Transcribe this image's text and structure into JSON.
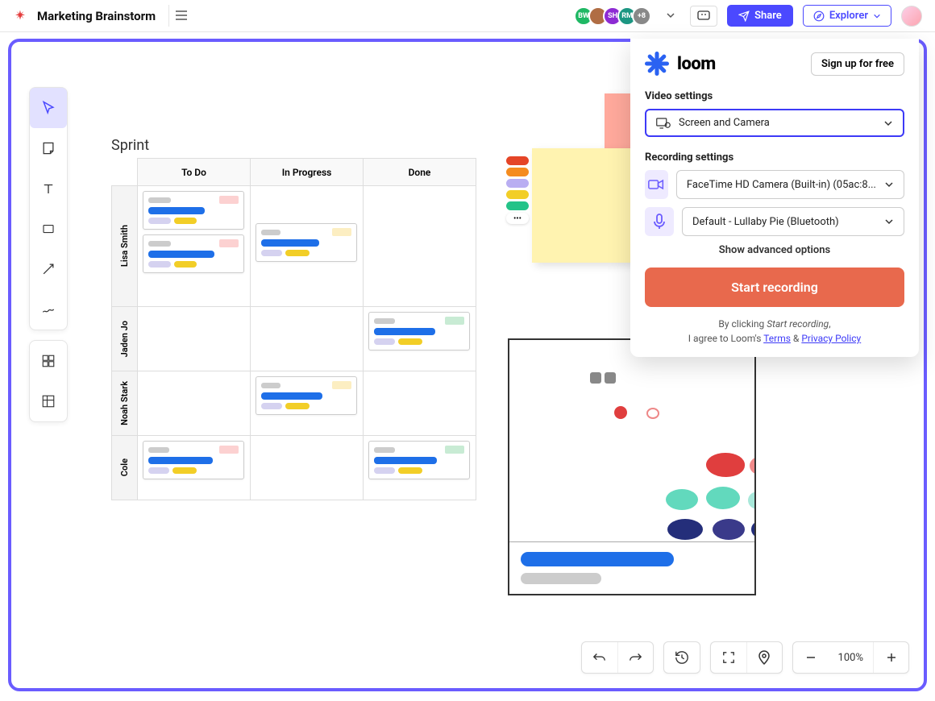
{
  "header": {
    "title": "Marketing Brainstorm",
    "share_label": "Share",
    "explorer_label": "Explorer",
    "avatars": [
      {
        "label": "BW",
        "bg": "#1fb864"
      },
      {
        "label": "",
        "bg": "#b06d44"
      },
      {
        "label": "SH",
        "bg": "#8d2bd3"
      },
      {
        "label": "RM",
        "bg": "#1c9682"
      }
    ],
    "more_count": "+8"
  },
  "sprint": {
    "title": "Sprint",
    "columns": [
      "To Do",
      "In Progress",
      "Done"
    ],
    "rows": [
      "Lisa Smith",
      "Jaden Jo",
      "Noah Stark",
      "Cole"
    ]
  },
  "sticky_colors": [
    "#e54527",
    "#f58c1f",
    "#b9aef2",
    "#f2ce27",
    "#24c388"
  ],
  "loom": {
    "brand": "loom",
    "signup": "Sign up for free",
    "video_settings_label": "Video settings",
    "video_mode": "Screen and Camera",
    "recording_settings_label": "Recording settings",
    "camera": "FaceTime HD Camera (Built-in) (05ac:8...",
    "microphone": "Default - Lullaby Pie (Bluetooth)",
    "advanced": "Show advanced options",
    "start": "Start recording",
    "terms_prefix": "By clicking ",
    "terms_em": "Start recording",
    "terms_mid": ",",
    "terms_line2_prefix": "I agree to Loom's ",
    "terms_link1": "Terms",
    "terms_amp": " & ",
    "terms_link2": "Privacy Policy"
  },
  "zoom": "100%"
}
